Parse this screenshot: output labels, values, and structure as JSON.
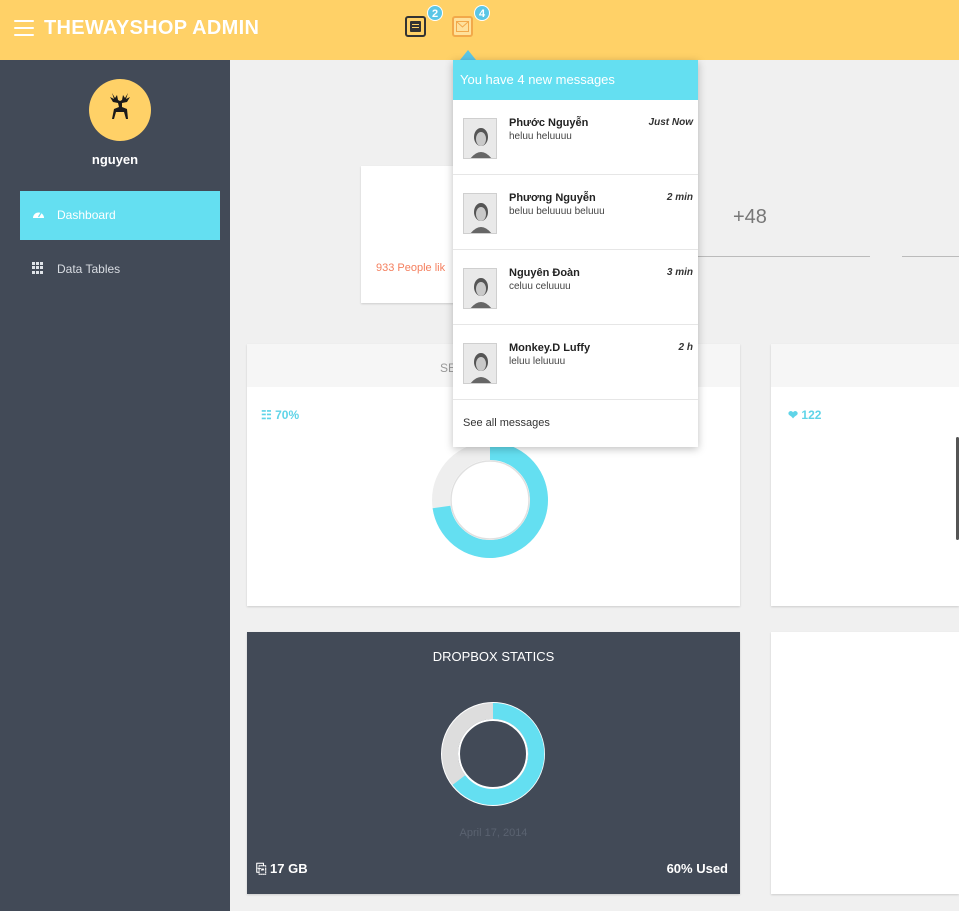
{
  "header": {
    "brand": "THEWAYSHOP ADMIN",
    "tasks_badge": "2",
    "messages_badge": "4",
    "accent_color": "#ffd167"
  },
  "sidebar": {
    "username": "nguyen",
    "items": [
      {
        "label": "Dashboard",
        "icon": "dashboard-icon",
        "active": true
      },
      {
        "label": "Data Tables",
        "icon": "table-icon",
        "active": false
      }
    ],
    "bg_color": "#424a57",
    "active_color": "#64dff1"
  },
  "content": {
    "people_like": "933 People lik",
    "plus_count": "+48",
    "server_title": "SE",
    "server_stat": "70%",
    "likes_stat": "122",
    "dropbox": {
      "title": "DROPBOX STATICS",
      "date": "April 17, 2014",
      "size": "17 GB",
      "used": "60% Used"
    }
  },
  "messages_dropdown": {
    "header": "You have 4 new messages",
    "items": [
      {
        "name": "Phước Nguyễn",
        "text": "heluu heluuuu",
        "time": "Just Now"
      },
      {
        "name": "Phương Nguyễn",
        "text": "beluu beluuuu beluuu",
        "time": "2 min"
      },
      {
        "name": "Nguyên Đoàn",
        "text": "celuu celuuuu",
        "time": "3 min"
      },
      {
        "name": "Monkey.D Luffy",
        "text": "leluu leluuuu",
        "time": "2 h"
      }
    ],
    "footer": "See all messages"
  }
}
